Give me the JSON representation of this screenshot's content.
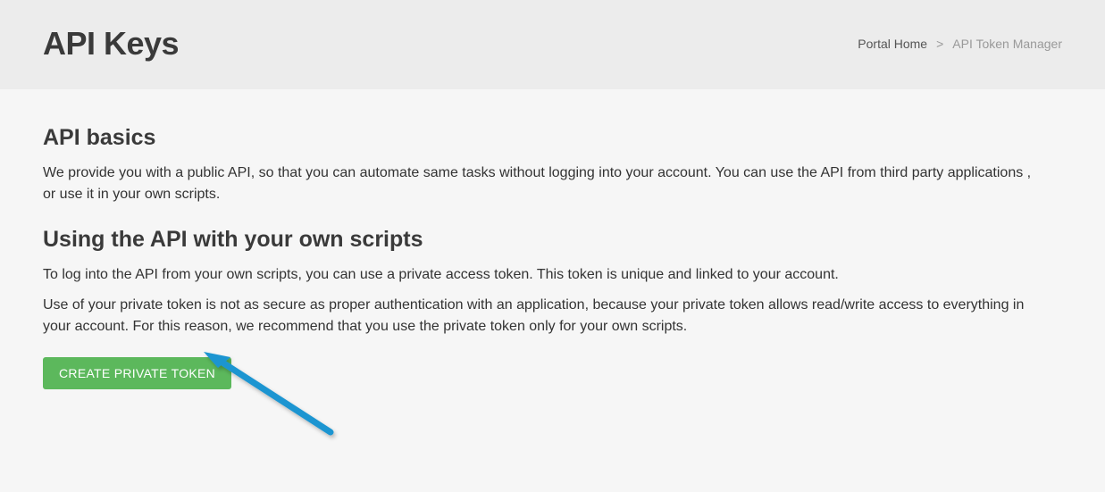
{
  "header": {
    "title": "API Keys"
  },
  "breadcrumb": {
    "home": "Portal Home",
    "separator": ">",
    "current": "API Token Manager"
  },
  "sections": {
    "basics": {
      "heading": "API basics",
      "paragraph": "We provide you with a public API, so that you can automate same tasks without logging into your account. You can use the API from third party applications , or use it in your own scripts."
    },
    "scripts": {
      "heading": "Using the API with your own scripts",
      "paragraph1": "To log into the API from your own scripts, you can use a private access token. This token is unique and linked to your account.",
      "paragraph2": "Use of your private token is not as secure as proper authentication with an application, because your private token allows read/write access to everything in your account. For this reason, we recommend that you use the private token only for your own scripts."
    }
  },
  "buttons": {
    "create_token": "CREATE PRIVATE TOKEN"
  },
  "colors": {
    "button_bg": "#5cb85c",
    "arrow": "#1b95d1"
  }
}
